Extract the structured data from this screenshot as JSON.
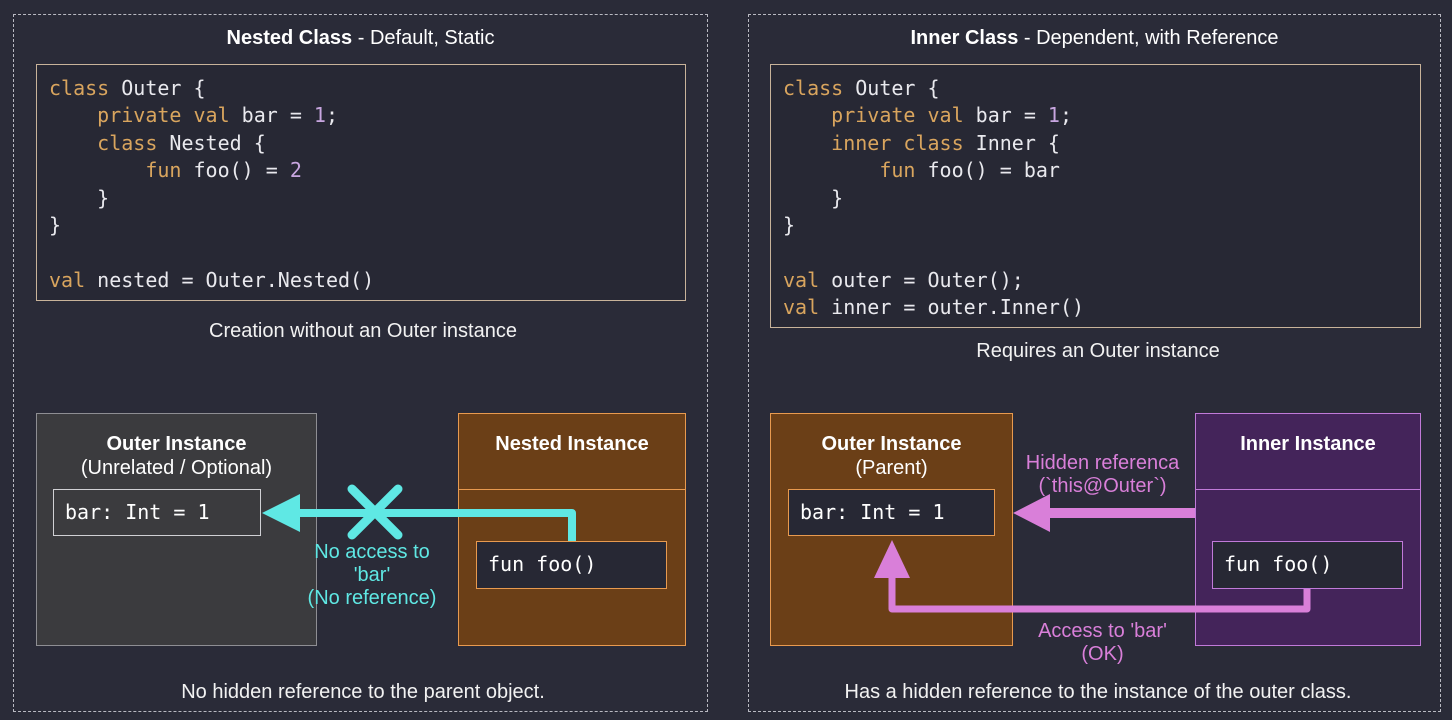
{
  "colors": {
    "background": "#2a2b38",
    "keyword": "#d9a55e",
    "number": "#c8a6e0",
    "cyan_arrow": "#5fe8e4",
    "magenta_arrow": "#d97fd9",
    "nested_box": "#6b3f17",
    "inner_box": "#44245a"
  },
  "left": {
    "title_bold": "Nested Class",
    "title_rest": " - Default, Static",
    "code": [
      [
        {
          "t": "class",
          "c": "kw"
        },
        {
          "t": " Outer {"
        }
      ],
      [
        {
          "t": "    "
        },
        {
          "t": "private val",
          "c": "kw"
        },
        {
          "t": " bar = "
        },
        {
          "t": "1",
          "c": "num"
        },
        {
          "t": ";"
        }
      ],
      [
        {
          "t": "    "
        },
        {
          "t": "class",
          "c": "kw"
        },
        {
          "t": " Nested {"
        }
      ],
      [
        {
          "t": "        "
        },
        {
          "t": "fun",
          "c": "kw"
        },
        {
          "t": " foo() = "
        },
        {
          "t": "2",
          "c": "num"
        }
      ],
      [
        {
          "t": "    }"
        }
      ],
      [
        {
          "t": "}"
        }
      ],
      [
        {
          "t": ""
        }
      ],
      [
        {
          "t": "val",
          "c": "kw"
        },
        {
          "t": " nested = Outer.Nested()"
        }
      ]
    ],
    "caption": "Creation without an Outer instance",
    "outer_title": "Outer Instance",
    "outer_sub": "(Unrelated / Optional)",
    "outer_field": "bar: Int = 1",
    "nested_title": "Nested Instance",
    "nested_field": "fun foo()",
    "arrow_label_1": "No access to",
    "arrow_label_2": "'bar'",
    "arrow_label_3": "(No reference)",
    "bottom_caption": "No hidden reference to the parent object."
  },
  "right": {
    "title_bold": "Inner Class",
    "title_rest": " - Dependent, with Reference",
    "code": [
      [
        {
          "t": "class",
          "c": "kw"
        },
        {
          "t": " Outer {"
        }
      ],
      [
        {
          "t": "    "
        },
        {
          "t": "private val",
          "c": "kw"
        },
        {
          "t": " bar = "
        },
        {
          "t": "1",
          "c": "num"
        },
        {
          "t": ";"
        }
      ],
      [
        {
          "t": "    "
        },
        {
          "t": "inner class",
          "c": "kw"
        },
        {
          "t": " Inner {"
        }
      ],
      [
        {
          "t": "        "
        },
        {
          "t": "fun",
          "c": "kw"
        },
        {
          "t": " foo() = bar"
        }
      ],
      [
        {
          "t": "    }"
        }
      ],
      [
        {
          "t": "}"
        }
      ],
      [
        {
          "t": ""
        }
      ],
      [
        {
          "t": "val",
          "c": "kw"
        },
        {
          "t": " outer = Outer();"
        }
      ],
      [
        {
          "t": "val",
          "c": "kw"
        },
        {
          "t": " inner = outer.Inner()"
        }
      ]
    ],
    "caption": "Requires an Outer instance",
    "outer_title": "Outer Instance",
    "outer_sub": "(Parent)",
    "outer_field": "bar: Int = 1",
    "inner_title": "Inner Instance",
    "inner_field": "fun foo()",
    "hidden_label_1": "Hidden referenca",
    "hidden_label_2": "(`this@Outer`)",
    "access_label_1": "Access to 'bar'",
    "access_label_2": "(OK)",
    "bottom_caption": "Has a hidden reference to the instance of the outer class."
  }
}
